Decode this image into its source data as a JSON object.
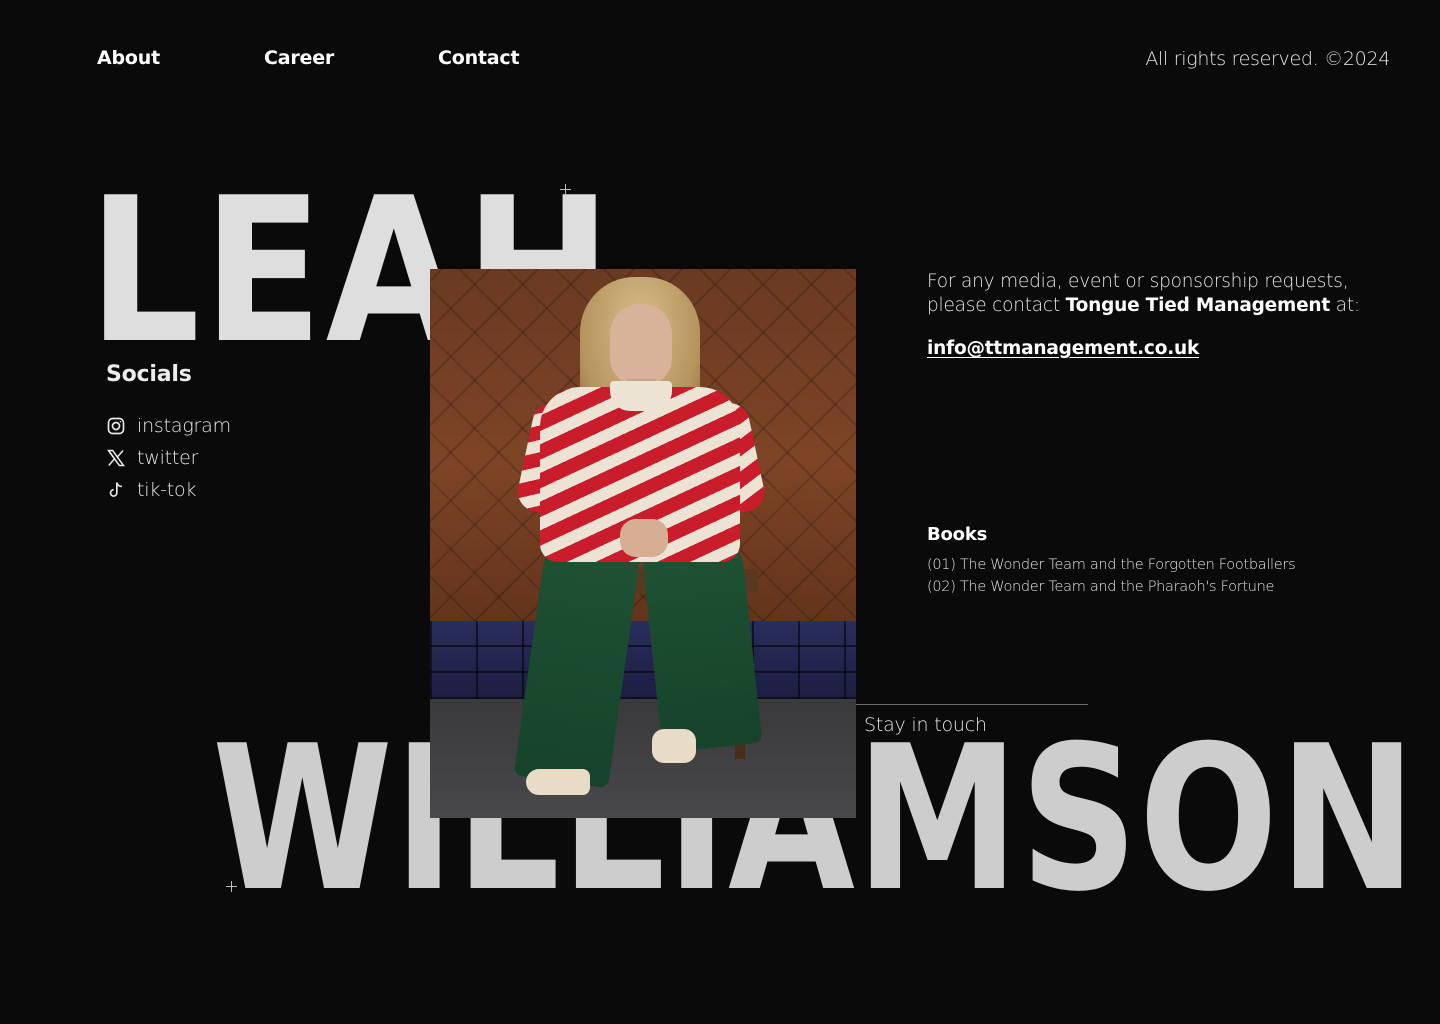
{
  "nav": {
    "items": [
      {
        "label": "About"
      },
      {
        "label": "Career"
      },
      {
        "label": "Contact"
      }
    ],
    "rights": "All rights reserved. ©2024"
  },
  "hero": {
    "first_name": "LEAH",
    "last_name": "WILLIAMSON"
  },
  "socials": {
    "title": "Socials",
    "items": [
      {
        "label": "instagram",
        "icon": "instagram-icon"
      },
      {
        "label": "twitter",
        "icon": "x-twitter-icon"
      },
      {
        "label": "tik-tok",
        "icon": "tiktok-icon"
      }
    ]
  },
  "contact": {
    "line1": "For any media, event or sponsorship requests,",
    "line2_prefix": "please contact ",
    "agency": "Tongue Tied Management",
    "line2_suffix": " at:",
    "email": "info@ttmanagement.co.uk"
  },
  "books": {
    "title": "Books",
    "items": [
      "(01) The Wonder Team and the Forgotten Footballers",
      "(02) The Wonder Team and the Pharaoh's Fortune"
    ]
  },
  "footer": {
    "stay_in_touch": "Stay in touch"
  },
  "colors": {
    "background": "#0a0a0b",
    "headline": "#dedede",
    "text": "#e6e6e6"
  }
}
